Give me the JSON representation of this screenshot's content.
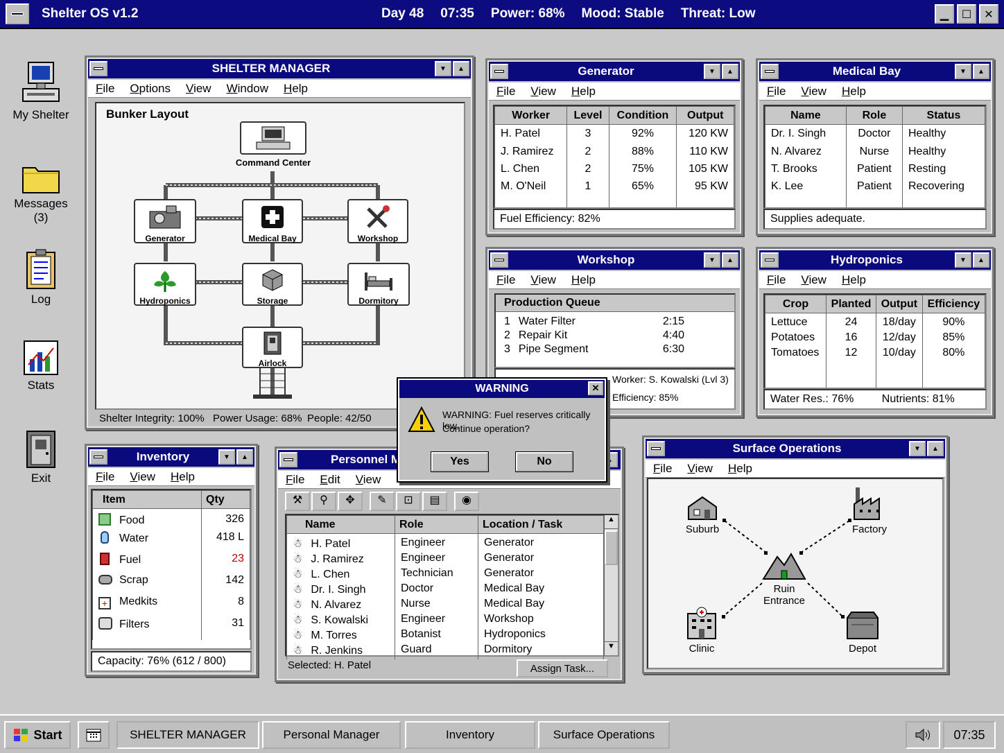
{
  "titlebar": {
    "app_title": "Shelter OS v1.2",
    "day": "Day 48",
    "time": "07:35",
    "power": "Power: 68%",
    "mood": "Mood: Stable",
    "threat": "Threat: Low"
  },
  "desktop": {
    "icons": [
      {
        "label": "My Shelter",
        "icon": "computer-icon"
      },
      {
        "label": "Messages\n(3)",
        "icon": "folder-icon"
      },
      {
        "label": "Log",
        "icon": "clipboard-icon"
      },
      {
        "label": "Stats",
        "icon": "chart-icon"
      },
      {
        "label": "Exit",
        "icon": "door-icon"
      }
    ]
  },
  "shelter_manager": {
    "title": "SHELTER MANAGER",
    "menu": [
      "File",
      "Options",
      "View",
      "Window",
      "Help"
    ],
    "layout_title": "Bunker Layout",
    "rooms": {
      "command": "Command Center",
      "generator": "Generator",
      "medical": "Medical Bay",
      "workshop": "Workshop",
      "hydroponics": "Hydroponics",
      "storage": "Storage",
      "dormitory": "Dormitory",
      "airlock": "Airlock"
    },
    "status": {
      "integrity": "Shelter Integrity: 100%",
      "power": "Power Usage: 68%",
      "people": "People: 42/50"
    }
  },
  "generator": {
    "title": "Generator",
    "menu": [
      "File",
      "View",
      "Help"
    ],
    "columns": [
      "Worker",
      "Level",
      "Condition",
      "Output"
    ],
    "rows": [
      [
        "H. Patel",
        "3",
        "92%",
        "120 KW"
      ],
      [
        "J. Ramirez",
        "2",
        "88%",
        "110 KW"
      ],
      [
        "L. Chen",
        "2",
        "75%",
        "105 KW"
      ],
      [
        "M. O'Neil",
        "1",
        "65%",
        "95 KW"
      ]
    ],
    "footer": "Fuel Efficiency: 82%"
  },
  "medical": {
    "title": "Medical Bay",
    "menu": [
      "File",
      "View",
      "Help"
    ],
    "columns": [
      "Name",
      "Role",
      "Status"
    ],
    "rows": [
      [
        "Dr. I. Singh",
        "Doctor",
        "Healthy"
      ],
      [
        "N. Alvarez",
        "Nurse",
        "Healthy"
      ],
      [
        "T. Brooks",
        "Patient",
        "Resting"
      ],
      [
        "K. Lee",
        "Patient",
        "Recovering"
      ]
    ],
    "footer": "Supplies adequate."
  },
  "workshop": {
    "title": "Workshop",
    "menu": [
      "File",
      "View",
      "Help"
    ],
    "queue_title": "Production Queue",
    "queue": [
      [
        "1",
        "Water Filter",
        "2:15"
      ],
      [
        "2",
        "Repair Kit",
        "4:40"
      ],
      [
        "3",
        "Pipe Segment",
        "6:30"
      ]
    ],
    "worker": "Worker: S. Kowalski (Lvl 3)",
    "efficiency": "Efficiency: 85%"
  },
  "hydroponics": {
    "title": "Hydroponics",
    "menu": [
      "File",
      "View",
      "Help"
    ],
    "columns": [
      "Crop",
      "Planted",
      "Output",
      "Efficiency"
    ],
    "rows": [
      [
        "Lettuce",
        "24",
        "18/day",
        "90%"
      ],
      [
        "Potatoes",
        "16",
        "12/day",
        "85%"
      ],
      [
        "Tomatoes",
        "12",
        "10/day",
        "80%"
      ]
    ],
    "water": "Water Res.: 76%",
    "nutrients": "Nutrients: 81%"
  },
  "warning": {
    "title": "WARNING",
    "close": "✕",
    "line1": "WARNING: Fuel reserves critically low.",
    "line2": "Continue operation?",
    "yes": "Yes",
    "no": "No"
  },
  "inventory": {
    "title": "Inventory",
    "menu": [
      "File",
      "View",
      "Help"
    ],
    "columns": [
      "Item",
      "Qty"
    ],
    "rows": [
      {
        "item": "Food",
        "qty": "326"
      },
      {
        "item": "Water",
        "qty": "418 L"
      },
      {
        "item": "Fuel",
        "qty": "23"
      },
      {
        "item": "Scrap",
        "qty": "142"
      },
      {
        "item": "Medkits",
        "qty": "8"
      },
      {
        "item": "Filters",
        "qty": "31"
      }
    ],
    "footer": "Capacity: 76% (612 / 800)"
  },
  "personnel": {
    "title": "Personnel M",
    "menu": [
      "File",
      "Edit",
      "View"
    ],
    "columns": [
      "Name",
      "Role",
      "Location / Task"
    ],
    "rows": [
      [
        "H. Patel",
        "Engineer",
        "Generator"
      ],
      [
        "J. Ramirez",
        "Engineer",
        "Generator"
      ],
      [
        "L. Chen",
        "Technician",
        "Generator"
      ],
      [
        "Dr. I. Singh",
        "Doctor",
        "Medical Bay"
      ],
      [
        "N. Alvarez",
        "Nurse",
        "Medical Bay"
      ],
      [
        "S. Kowalski",
        "Engineer",
        "Workshop"
      ],
      [
        "M. Torres",
        "Botanist",
        "Hydroponics"
      ],
      [
        "R. Jenkins",
        "Guard",
        "Dormitory"
      ]
    ],
    "selected": "Selected: H. Patel",
    "assign": "Assign Task..."
  },
  "surface": {
    "title": "Surface Operations",
    "menu": [
      "File",
      "View",
      "Help"
    ],
    "nodes": {
      "suburb": "Suburb",
      "factory": "Factory",
      "ruin": "Ruin\nEntrance",
      "clinic": "Clinic",
      "depot": "Depot"
    }
  },
  "taskbar": {
    "start": "Start",
    "items": [
      "SHELTER MANAGER",
      "Personal Manager",
      "Inventory",
      "Surface Operations"
    ],
    "clock": "07:35"
  },
  "colors": {
    "titlebar": "#0c0c80",
    "desktop": "#c9c9c9",
    "alert": "#b00000"
  }
}
